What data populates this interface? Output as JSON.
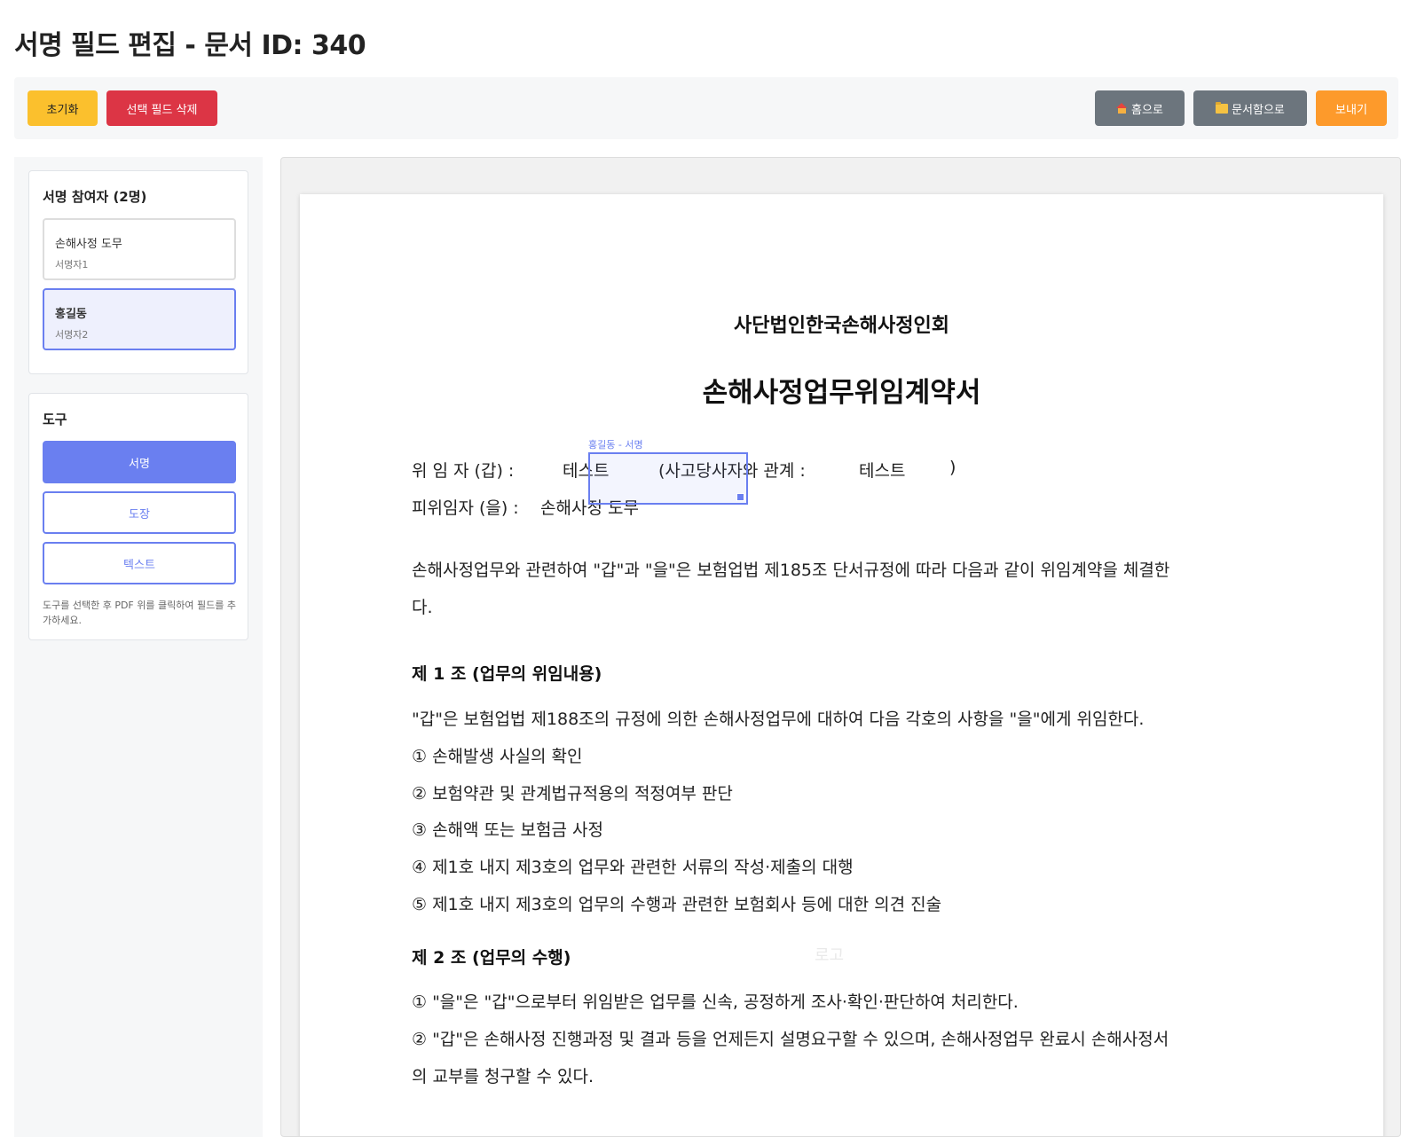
{
  "page": {
    "title": "서명 필드 편집 - 문서 ID: 340"
  },
  "toolbar": {
    "reset_label": "초기화",
    "delete_label": "선택 필드 삭제",
    "home_label": "홈으로",
    "docs_label": "문서함으로",
    "send_label": "보내기"
  },
  "participants": {
    "title": "서명 참여자 (2명)",
    "items": [
      {
        "name": "손해사정 도무",
        "role": "서명자1",
        "selected": false
      },
      {
        "name": "홍길동",
        "role": "서명자2",
        "selected": true
      }
    ]
  },
  "tools": {
    "title": "도구",
    "items": [
      {
        "label": "서명",
        "active": true
      },
      {
        "label": "도장",
        "active": false
      },
      {
        "label": "텍스트",
        "active": false
      }
    ],
    "hint": "도구를 선택한 후 PDF 위를 클릭하여 필드를 추가하세요."
  },
  "document": {
    "organization": "사단법인한국손해사정인회",
    "title": "손해사정업무위임계약서",
    "delegator_label": "위 임 자 (갑) :",
    "delegator_name": "테스트",
    "relation_label": "(사고당사자와 관계 :",
    "relation_value": "테스트",
    "relation_close": ")",
    "delegate_label": "피위임자 (을) :",
    "delegate_name": "손해사정 도무",
    "intro_line1": "손해사정업무와 관련하여 \"갑\"과 \"을\"은 보험업법 제185조 단서규정에 따라 다음과 같이 위임계약을 체결한",
    "intro_line2": "다.",
    "article1_title": "제 1 조 (업무의 위임내용)",
    "article1_lead": "\"갑\"은 보험업법 제188조의 규정에 의한 손해사정업무에 대하여 다음 각호의 사항을 \"을\"에게 위임한다.",
    "article1_items": [
      "① 손해발생 사실의 확인",
      "② 보험약관 및 관계법규적용의 적정여부 판단",
      "③ 손해액 또는 보험금 사정",
      "④ 제1호 내지 제3호의 업무와 관련한 서류의 작성·제출의 대행",
      "⑤ 제1호 내지 제3호의 업무의 수행과 관련한 보험회사 등에 대한 의견 진술"
    ],
    "watermark": "로고",
    "article2_title": "제 2 조 (업무의 수행)",
    "article2_lines": [
      "① \"을\"은 \"갑\"으로부터 위임받은 업무를 신속, 공정하게 조사·확인·판단하여 처리한다.",
      "② \"갑\"은 손해사정 진행과정 및 결과 등을 언제든지 설명요구할 수 있으며, 손해사정업무 완료시 손해사정서",
      "의 교부를 청구할 수 있다."
    ]
  },
  "signature_field": {
    "label": "홍길동 - 서명"
  },
  "colors": {
    "accent": "#6a7ff0",
    "reset": "#fbc02d",
    "delete": "#dc3545",
    "neutral": "#6c757d",
    "send": "#fd9a2b"
  }
}
